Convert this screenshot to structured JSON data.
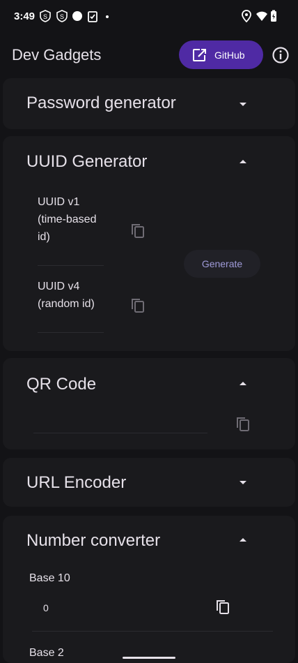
{
  "status": {
    "time": "3:49",
    "icons": [
      "shield-s-icon",
      "shield-s-icon",
      "circle-icon",
      "clipboard-check-icon",
      "dot-icon",
      "location-icon",
      "wifi-icon",
      "battery-icon"
    ]
  },
  "appbar": {
    "title": "Dev Gadgets",
    "github_label": "GitHub"
  },
  "sections": {
    "password": {
      "title": "Password generator",
      "expanded": false
    },
    "uuid": {
      "title": "UUID Generator",
      "expanded": true,
      "v1_label": "UUID v1\n(time-based\nid)",
      "v4_label": "UUID v4\n(random id)",
      "generate_label": "Generate"
    },
    "qr": {
      "title": "QR Code",
      "expanded": true
    },
    "url": {
      "title": "URL Encoder",
      "expanded": false
    },
    "number": {
      "title": "Number converter",
      "expanded": true,
      "base10_label": "Base 10",
      "base10_value": "0",
      "next_label": "Base 2"
    }
  },
  "colors": {
    "background": "#131316",
    "card": "#1a1a1d",
    "accent": "#4f2aa4",
    "button_text": "#9f9ad8"
  }
}
